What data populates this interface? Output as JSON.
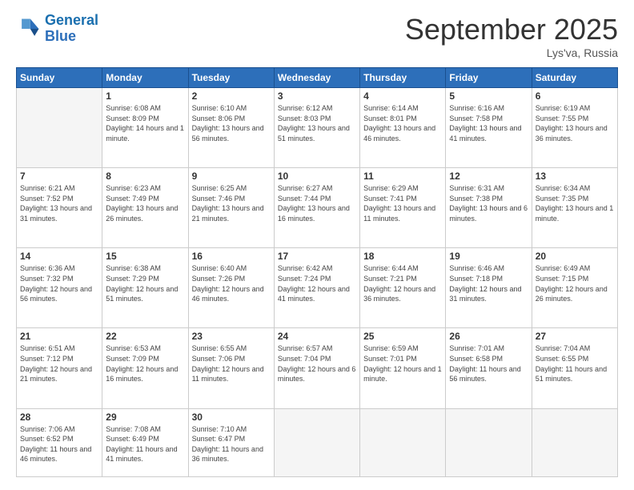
{
  "header": {
    "logo_line1": "General",
    "logo_line2": "Blue",
    "month_title": "September 2025",
    "location": "Lys'va, Russia"
  },
  "weekdays": [
    "Sunday",
    "Monday",
    "Tuesday",
    "Wednesday",
    "Thursday",
    "Friday",
    "Saturday"
  ],
  "weeks": [
    [
      {
        "day": "",
        "sunrise": "",
        "sunset": "",
        "daylight": ""
      },
      {
        "day": "1",
        "sunrise": "Sunrise: 6:08 AM",
        "sunset": "Sunset: 8:09 PM",
        "daylight": "Daylight: 14 hours and 1 minute."
      },
      {
        "day": "2",
        "sunrise": "Sunrise: 6:10 AM",
        "sunset": "Sunset: 8:06 PM",
        "daylight": "Daylight: 13 hours and 56 minutes."
      },
      {
        "day": "3",
        "sunrise": "Sunrise: 6:12 AM",
        "sunset": "Sunset: 8:03 PM",
        "daylight": "Daylight: 13 hours and 51 minutes."
      },
      {
        "day": "4",
        "sunrise": "Sunrise: 6:14 AM",
        "sunset": "Sunset: 8:01 PM",
        "daylight": "Daylight: 13 hours and 46 minutes."
      },
      {
        "day": "5",
        "sunrise": "Sunrise: 6:16 AM",
        "sunset": "Sunset: 7:58 PM",
        "daylight": "Daylight: 13 hours and 41 minutes."
      },
      {
        "day": "6",
        "sunrise": "Sunrise: 6:19 AM",
        "sunset": "Sunset: 7:55 PM",
        "daylight": "Daylight: 13 hours and 36 minutes."
      }
    ],
    [
      {
        "day": "7",
        "sunrise": "Sunrise: 6:21 AM",
        "sunset": "Sunset: 7:52 PM",
        "daylight": "Daylight: 13 hours and 31 minutes."
      },
      {
        "day": "8",
        "sunrise": "Sunrise: 6:23 AM",
        "sunset": "Sunset: 7:49 PM",
        "daylight": "Daylight: 13 hours and 26 minutes."
      },
      {
        "day": "9",
        "sunrise": "Sunrise: 6:25 AM",
        "sunset": "Sunset: 7:46 PM",
        "daylight": "Daylight: 13 hours and 21 minutes."
      },
      {
        "day": "10",
        "sunrise": "Sunrise: 6:27 AM",
        "sunset": "Sunset: 7:44 PM",
        "daylight": "Daylight: 13 hours and 16 minutes."
      },
      {
        "day": "11",
        "sunrise": "Sunrise: 6:29 AM",
        "sunset": "Sunset: 7:41 PM",
        "daylight": "Daylight: 13 hours and 11 minutes."
      },
      {
        "day": "12",
        "sunrise": "Sunrise: 6:31 AM",
        "sunset": "Sunset: 7:38 PM",
        "daylight": "Daylight: 13 hours and 6 minutes."
      },
      {
        "day": "13",
        "sunrise": "Sunrise: 6:34 AM",
        "sunset": "Sunset: 7:35 PM",
        "daylight": "Daylight: 13 hours and 1 minute."
      }
    ],
    [
      {
        "day": "14",
        "sunrise": "Sunrise: 6:36 AM",
        "sunset": "Sunset: 7:32 PM",
        "daylight": "Daylight: 12 hours and 56 minutes."
      },
      {
        "day": "15",
        "sunrise": "Sunrise: 6:38 AM",
        "sunset": "Sunset: 7:29 PM",
        "daylight": "Daylight: 12 hours and 51 minutes."
      },
      {
        "day": "16",
        "sunrise": "Sunrise: 6:40 AM",
        "sunset": "Sunset: 7:26 PM",
        "daylight": "Daylight: 12 hours and 46 minutes."
      },
      {
        "day": "17",
        "sunrise": "Sunrise: 6:42 AM",
        "sunset": "Sunset: 7:24 PM",
        "daylight": "Daylight: 12 hours and 41 minutes."
      },
      {
        "day": "18",
        "sunrise": "Sunrise: 6:44 AM",
        "sunset": "Sunset: 7:21 PM",
        "daylight": "Daylight: 12 hours and 36 minutes."
      },
      {
        "day": "19",
        "sunrise": "Sunrise: 6:46 AM",
        "sunset": "Sunset: 7:18 PM",
        "daylight": "Daylight: 12 hours and 31 minutes."
      },
      {
        "day": "20",
        "sunrise": "Sunrise: 6:49 AM",
        "sunset": "Sunset: 7:15 PM",
        "daylight": "Daylight: 12 hours and 26 minutes."
      }
    ],
    [
      {
        "day": "21",
        "sunrise": "Sunrise: 6:51 AM",
        "sunset": "Sunset: 7:12 PM",
        "daylight": "Daylight: 12 hours and 21 minutes."
      },
      {
        "day": "22",
        "sunrise": "Sunrise: 6:53 AM",
        "sunset": "Sunset: 7:09 PM",
        "daylight": "Daylight: 12 hours and 16 minutes."
      },
      {
        "day": "23",
        "sunrise": "Sunrise: 6:55 AM",
        "sunset": "Sunset: 7:06 PM",
        "daylight": "Daylight: 12 hours and 11 minutes."
      },
      {
        "day": "24",
        "sunrise": "Sunrise: 6:57 AM",
        "sunset": "Sunset: 7:04 PM",
        "daylight": "Daylight: 12 hours and 6 minutes."
      },
      {
        "day": "25",
        "sunrise": "Sunrise: 6:59 AM",
        "sunset": "Sunset: 7:01 PM",
        "daylight": "Daylight: 12 hours and 1 minute."
      },
      {
        "day": "26",
        "sunrise": "Sunrise: 7:01 AM",
        "sunset": "Sunset: 6:58 PM",
        "daylight": "Daylight: 11 hours and 56 minutes."
      },
      {
        "day": "27",
        "sunrise": "Sunrise: 7:04 AM",
        "sunset": "Sunset: 6:55 PM",
        "daylight": "Daylight: 11 hours and 51 minutes."
      }
    ],
    [
      {
        "day": "28",
        "sunrise": "Sunrise: 7:06 AM",
        "sunset": "Sunset: 6:52 PM",
        "daylight": "Daylight: 11 hours and 46 minutes."
      },
      {
        "day": "29",
        "sunrise": "Sunrise: 7:08 AM",
        "sunset": "Sunset: 6:49 PM",
        "daylight": "Daylight: 11 hours and 41 minutes."
      },
      {
        "day": "30",
        "sunrise": "Sunrise: 7:10 AM",
        "sunset": "Sunset: 6:47 PM",
        "daylight": "Daylight: 11 hours and 36 minutes."
      },
      {
        "day": "",
        "sunrise": "",
        "sunset": "",
        "daylight": ""
      },
      {
        "day": "",
        "sunrise": "",
        "sunset": "",
        "daylight": ""
      },
      {
        "day": "",
        "sunrise": "",
        "sunset": "",
        "daylight": ""
      },
      {
        "day": "",
        "sunrise": "",
        "sunset": "",
        "daylight": ""
      }
    ]
  ]
}
